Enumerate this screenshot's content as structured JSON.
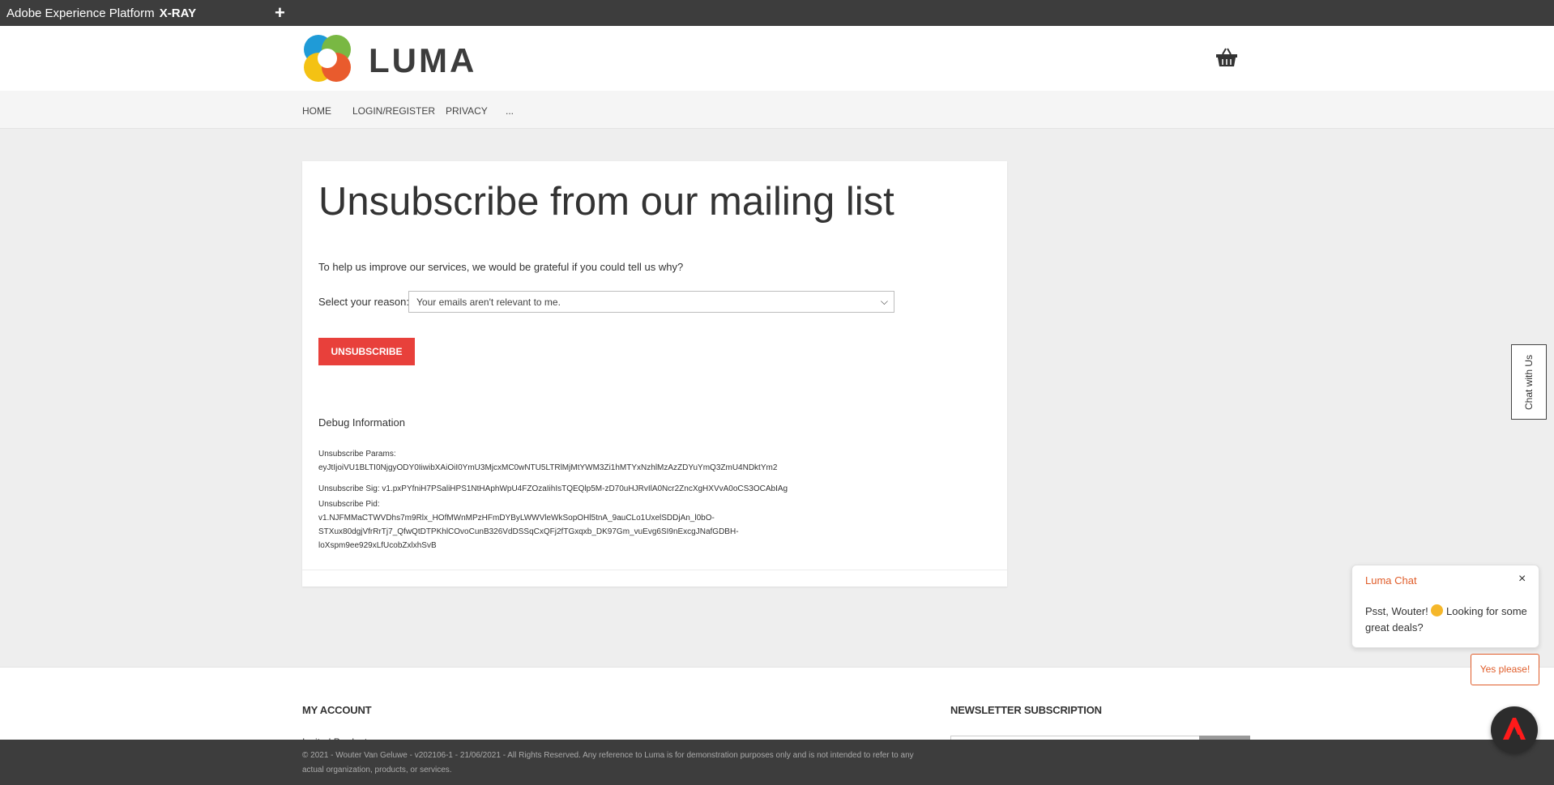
{
  "xray": {
    "title_prefix": "Adobe Experience Platform",
    "title_bold": "X-RAY",
    "add_label": "+"
  },
  "header": {
    "logo_text": "LUMA",
    "cart_icon": "basket-icon"
  },
  "nav": {
    "items": [
      "HOME",
      "LOGIN/REGISTER",
      "PRIVACY",
      "..."
    ]
  },
  "main": {
    "title": "Unsubscribe from our mailing list",
    "intro": "To help us improve our services, we would be grateful if you could tell us why?",
    "reason_label": "Select your reason:",
    "reason_selected": "Your emails aren't relevant to me.",
    "unsubscribe_button": "UNSUBSCRIBE",
    "debug": {
      "title": "Debug Information",
      "params_label": "Unsubscribe Params:",
      "params_value": "eyJtIjoiVU1BLTI0NjgyODY0IiwibXAiOiI0YmU3MjcxMC0wNTU5LTRlMjMtYWM3Zi1hMTYxNzhlMzAzZDYuYmQ3ZmU4NDktYm2",
      "sig_label": "Unsubscribe Sig:",
      "sig_value": "v1.pxPYfniH7PSaliHPS1NtHAphWpU4FZOzaIihIsTQEQlp5M-zD70uHJRvIlA0Ncr2ZncXgHXVvA0oCS3OCAbIAg",
      "pid_label": "Unsubscribe Pid:",
      "pid_lines": [
        "v1.NJFMMaCTWVDhs7m9Rlx_HOfMWnMPzHFmDYByLWWVleWkSopOHl5tnA_9auCLo1UxelSDDjAn_l0bO-",
        "STXux80dgjVfrRrTj7_QfwQtDTPKhlCOvoCunB326VdDSSqCxQFj2fTGxqxb_DK97Gm_vuEvg6SI9nExcgJNafGDBH-",
        "loXspm9ee929xLfUcobZxlxhSvB"
      ]
    }
  },
  "chat": {
    "tab_label": "Chat with Us",
    "name": "Luma Chat",
    "close_label": "×",
    "message_before": "Psst, Wouter!",
    "message_after": "Looking for some great deals?",
    "cta_label": "Yes please!"
  },
  "footer": {
    "my_account": "MY ACCOUNT",
    "newsletter": "NEWSLETTER SUBSCRIPTION",
    "sublink": "Invited Products",
    "copyright": "© 2021 - Wouter Van Geluwe - v202106-1 - 21/06/2021 - All Rights Reserved. Any reference to Luma is for demonstration purposes only and is not intended to refer to any actual organization, products, or services."
  }
}
